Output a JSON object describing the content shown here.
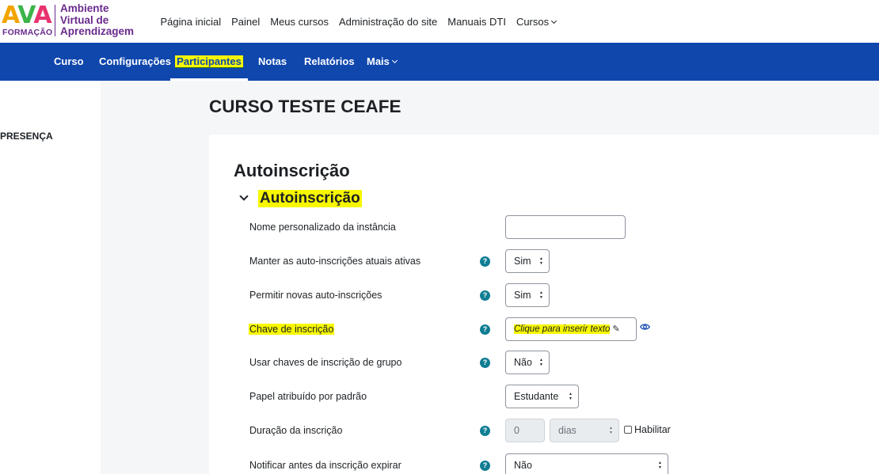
{
  "logo": {
    "ava": [
      "A",
      "V",
      "A"
    ],
    "sub": "FORMAÇÃO",
    "lines": [
      "Ambiente",
      "Virtual de",
      "Aprendizagem"
    ]
  },
  "topnav": {
    "items": [
      "Página inicial",
      "Painel",
      "Meus cursos",
      "Administração do site",
      "Manuais DTI",
      "Cursos"
    ]
  },
  "secnav": {
    "items": [
      "Curso",
      "Configurações",
      "Participantes",
      "Notas",
      "Relatórios",
      "Mais"
    ],
    "active": "Participantes"
  },
  "drawer": {
    "label": "PRESENÇA"
  },
  "course": {
    "title": "CURSO TESTE CEAFE"
  },
  "page": {
    "title": "Autoinscrição",
    "section": "Autoinscrição"
  },
  "form": {
    "instance_name": {
      "label": "Nome personalizado da instância",
      "value": ""
    },
    "keep_active": {
      "label": "Manter as auto-inscrições atuais ativas",
      "value": "Sim"
    },
    "allow_new": {
      "label": "Permitir novas auto-inscrições",
      "value": "Sim"
    },
    "key": {
      "label": "Chave de inscrição",
      "value": "Clique para inserir texto"
    },
    "group_keys": {
      "label": "Usar chaves de inscrição de grupo",
      "value": "Não"
    },
    "role": {
      "label": "Papel atribuído por padrão",
      "value": "Estudante"
    },
    "duration": {
      "label": "Duração da inscrição",
      "value": "0",
      "unit": "dias",
      "enable": "Habilitar"
    },
    "notify": {
      "label": "Notificar antes da inscrição expirar",
      "value": "Não"
    }
  },
  "colors": {
    "nav": "#0f47ad",
    "highlight": "#f7f700",
    "help": "#0f7d93",
    "logo": "#6a2a8c"
  },
  "icons": {
    "help": "question-circle-icon",
    "edit": "pencil-icon",
    "reveal": "eye-icon",
    "expand": "chevron-down-icon"
  }
}
